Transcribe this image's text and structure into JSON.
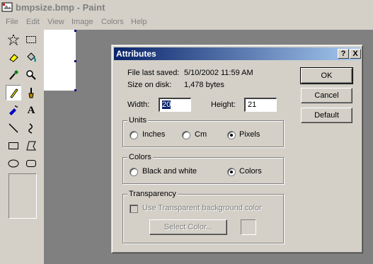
{
  "window": {
    "title": "bmpsize.bmp - Paint"
  },
  "menu": [
    "File",
    "Edit",
    "View",
    "Image",
    "Colors",
    "Help"
  ],
  "tools": [
    "free-form-select",
    "select",
    "eraser",
    "fill-with-color",
    "pick-color",
    "magnifier",
    "pencil",
    "brush",
    "airbrush",
    "text",
    "line",
    "curve",
    "rectangle",
    "polygon",
    "ellipse",
    "rounded-rectangle"
  ],
  "dialog": {
    "title": "Attributes",
    "help_btn": "?",
    "close_btn": "X",
    "file_saved_label": "File last saved:",
    "file_saved_value": "5/10/2002 11:59 AM",
    "size_label": "Size on disk:",
    "size_value": "1,478 bytes",
    "width_label": "Width:",
    "width_value": "20",
    "height_label": "Height:",
    "height_value": "21",
    "units": {
      "label": "Units",
      "options": [
        "Inches",
        "Cm",
        "Pixels"
      ],
      "selected": "Pixels"
    },
    "colors": {
      "label": "Colors",
      "options": [
        "Black and white",
        "Colors"
      ],
      "selected": "Colors"
    },
    "transparency": {
      "label": "Transparency",
      "checkbox_label": "Use Transparent background color",
      "checked": false,
      "select_color_btn": "Select Color..."
    },
    "buttons": {
      "ok": "OK",
      "cancel": "Cancel",
      "default": "Default"
    }
  }
}
